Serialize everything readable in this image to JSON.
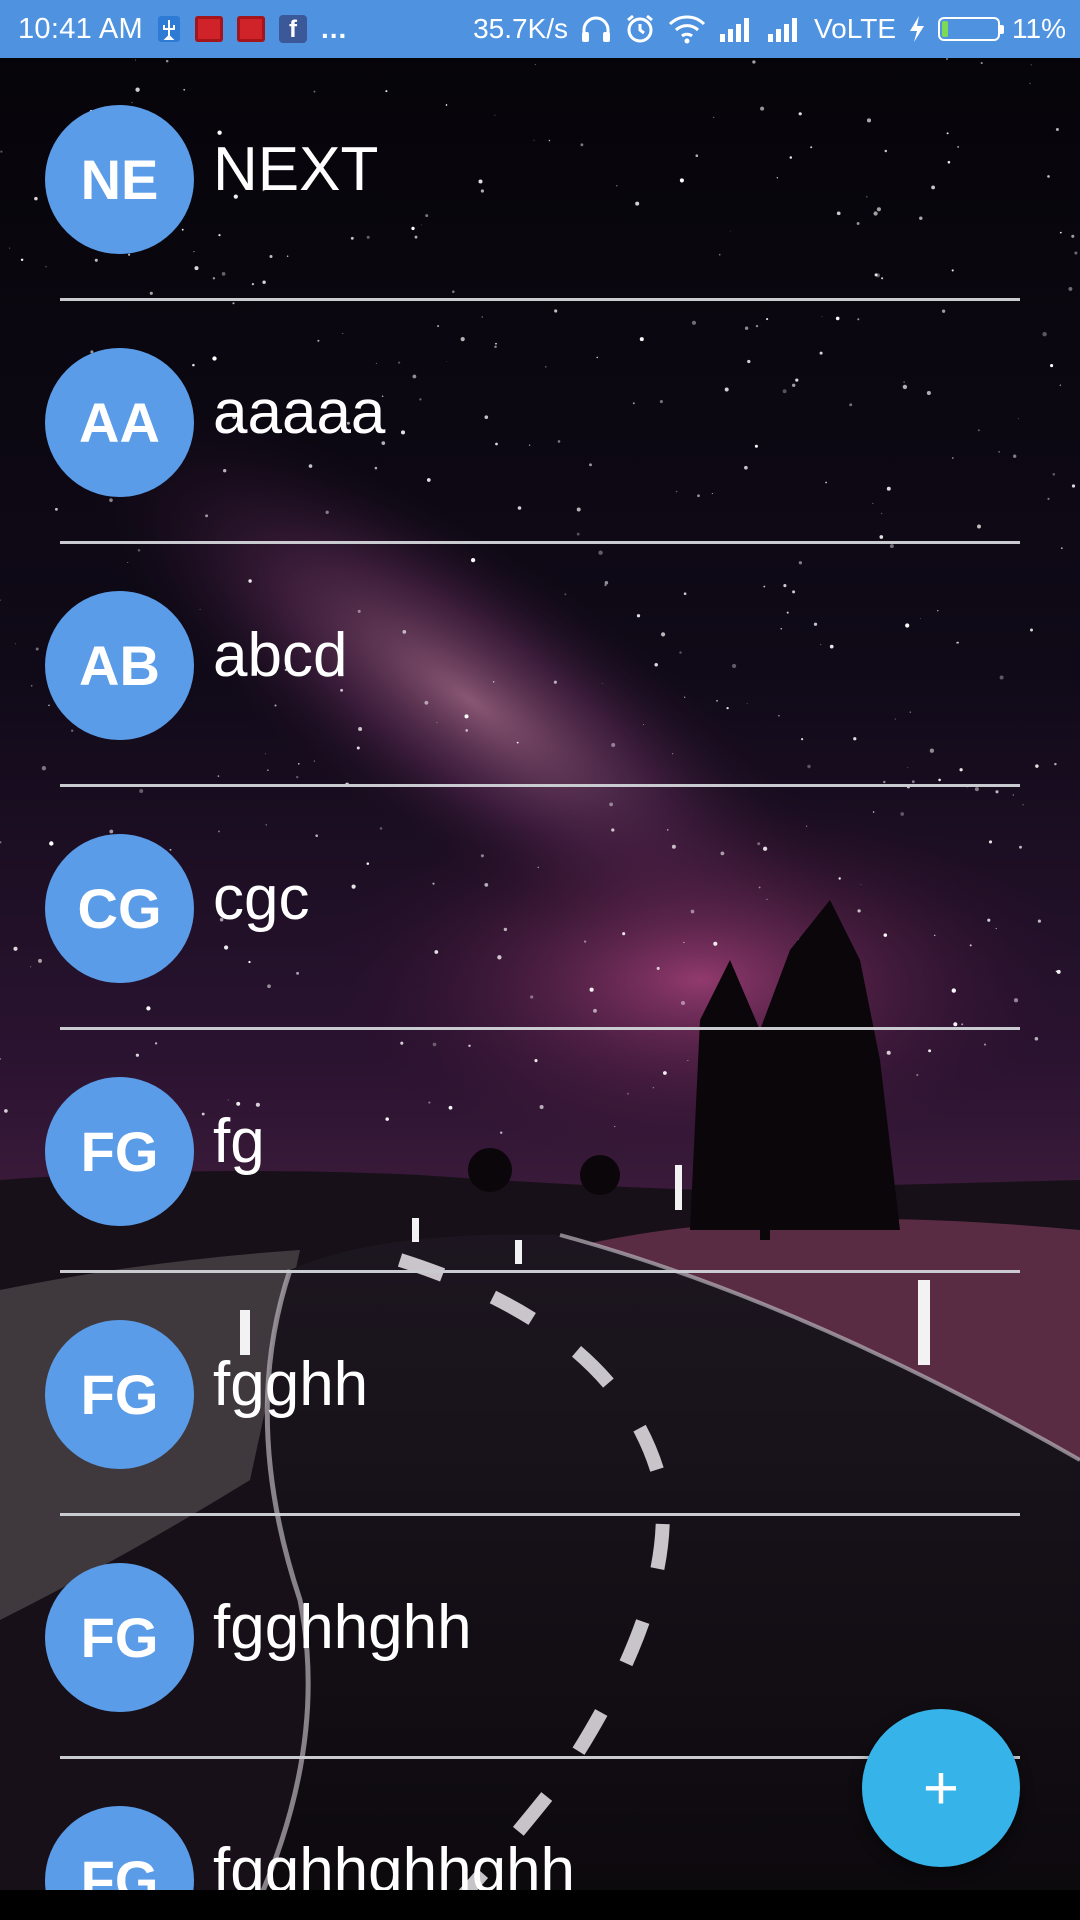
{
  "status_bar": {
    "time": "10:41 AM",
    "notification_icons": [
      "usb-debug-icon",
      "red-app-icon",
      "red-app-icon",
      "facebook-icon"
    ],
    "more_indicator": "...",
    "net_speed": "35.7K/s",
    "headphones_icon": "headphones-icon",
    "alarm_icon": "alarm-icon",
    "wifi_icon": "wifi-icon",
    "signal_icon": "signal-icon",
    "network_label": "VoLTE",
    "charging_icon": "lightning-icon",
    "battery_percent": "11%",
    "battery_level": 0.11,
    "color": "#4f93e0"
  },
  "contacts": [
    {
      "initials": "NE",
      "name": "NEXT"
    },
    {
      "initials": "AA",
      "name": "aaaaa"
    },
    {
      "initials": "AB",
      "name": "abcd"
    },
    {
      "initials": "CG",
      "name": "cgc"
    },
    {
      "initials": "FG",
      "name": "fg"
    },
    {
      "initials": "FG",
      "name": "fgghh"
    },
    {
      "initials": "FG",
      "name": "fgghhghh"
    },
    {
      "initials": "FG",
      "name": "fgghhghhghh"
    }
  ],
  "avatar_color": "#5a9ce8",
  "fab": {
    "label": "+",
    "color": "#36b3e8",
    "icon": "plus-icon"
  },
  "background": {
    "description_icon": "night-road-wallpaper"
  }
}
